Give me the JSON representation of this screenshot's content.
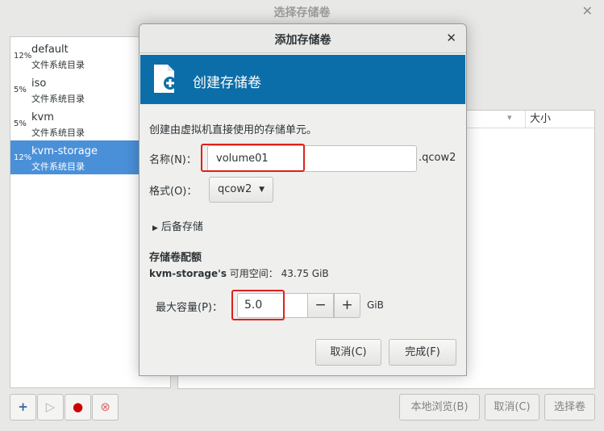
{
  "background": {
    "title": "选择存储卷",
    "close_glyph": "✕",
    "pools": [
      {
        "percent": "12%",
        "name": "default",
        "type": "文件系统目录",
        "selected": false
      },
      {
        "percent": "5%",
        "name": "iso",
        "type": "文件系统目录",
        "selected": false
      },
      {
        "percent": "5%",
        "name": "kvm",
        "type": "文件系统目录",
        "selected": false
      },
      {
        "percent": "12%",
        "name": "kvm-storage",
        "type": "文件系统目录",
        "selected": true
      }
    ],
    "volume_table": {
      "size_header": "大小",
      "sort_arrow": "▾"
    },
    "toolbar": {
      "add_glyph": "+",
      "start_glyph": "▷",
      "stop_glyph": "●",
      "delete_glyph": "⊗",
      "browse_local": "本地浏览(B)",
      "cancel": "取消(C)",
      "choose": "选择卷"
    }
  },
  "dialog": {
    "title": "添加存储卷",
    "close_glyph": "✕",
    "banner_title": "创建存储卷",
    "description": "创建由虚拟机直接使用的存储单元。",
    "name_label": "名称(N)：",
    "name_value": "volume01",
    "name_suffix": ".qcow2",
    "format_label": "格式(O)：",
    "format_value": "qcow2",
    "format_arrow": "▼",
    "backing_tri": "▶",
    "backing_label": "后备存储",
    "quota_title": "存储卷配额",
    "quota_pool": "kvm-storage's",
    "quota_available": " 可用空间： 43.75 GiB",
    "capacity_label": "最大容量(P)：",
    "capacity_value": "5.0",
    "minus_glyph": "−",
    "plus_glyph": "+",
    "capacity_unit": "GiB",
    "cancel_button": "取消(C)",
    "finish_button": "完成(F)"
  },
  "colors": {
    "banner": "#0c6ea8",
    "selection": "#4a90d9",
    "highlight": "#e0201b"
  }
}
